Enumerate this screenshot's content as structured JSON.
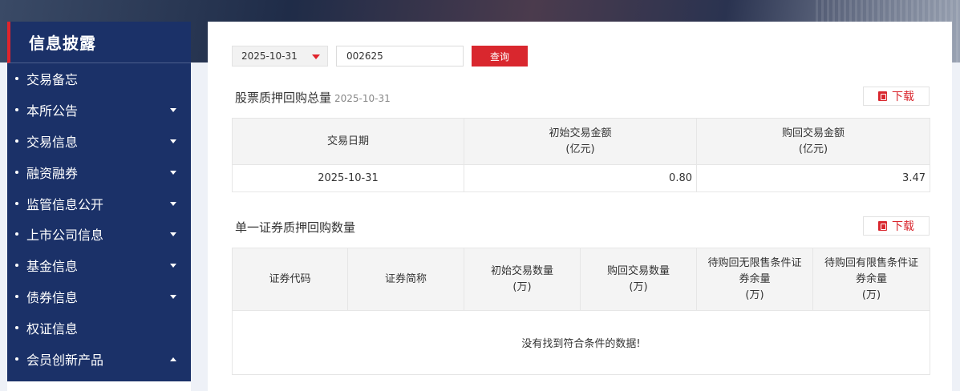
{
  "sidebar": {
    "title": "信息披露",
    "items": [
      {
        "label": "交易备忘",
        "caret": "none"
      },
      {
        "label": "本所公告",
        "caret": "down"
      },
      {
        "label": "交易信息",
        "caret": "down"
      },
      {
        "label": "融资融券",
        "caret": "down"
      },
      {
        "label": "监管信息公开",
        "caret": "down"
      },
      {
        "label": "上市公司信息",
        "caret": "down"
      },
      {
        "label": "基金信息",
        "caret": "down"
      },
      {
        "label": "债券信息",
        "caret": "down"
      },
      {
        "label": "权证信息",
        "caret": "none"
      },
      {
        "label": "会员创新产品",
        "caret": "up"
      }
    ]
  },
  "toolbar": {
    "date_value": "2025-10-31",
    "code_value": "002625",
    "query_label": "查询"
  },
  "section1": {
    "title": "股票质押回购总量",
    "date": "2025-10-31",
    "download_label": "下载",
    "headers": [
      [
        "交易日期"
      ],
      [
        "初始交易金额",
        "(亿元)"
      ],
      [
        "购回交易金额",
        "(亿元)"
      ]
    ],
    "rows": [
      [
        "2025-10-31",
        "0.80",
        "3.47"
      ]
    ]
  },
  "section2": {
    "title": "单一证券质押回购数量",
    "download_label": "下载",
    "headers": [
      [
        "证券代码"
      ],
      [
        "证券简称"
      ],
      [
        "初始交易数量",
        "(万)"
      ],
      [
        "购回交易数量",
        "(万)"
      ],
      [
        "待购回无限售条件证",
        "券余量",
        "(万)"
      ],
      [
        "待购回有限售条件证",
        "券余量",
        "(万)"
      ]
    ],
    "empty_message": "没有找到符合条件的数据!"
  },
  "colors": {
    "accent_red": "#d9272e",
    "sidebar_navy": "#1b3168"
  }
}
